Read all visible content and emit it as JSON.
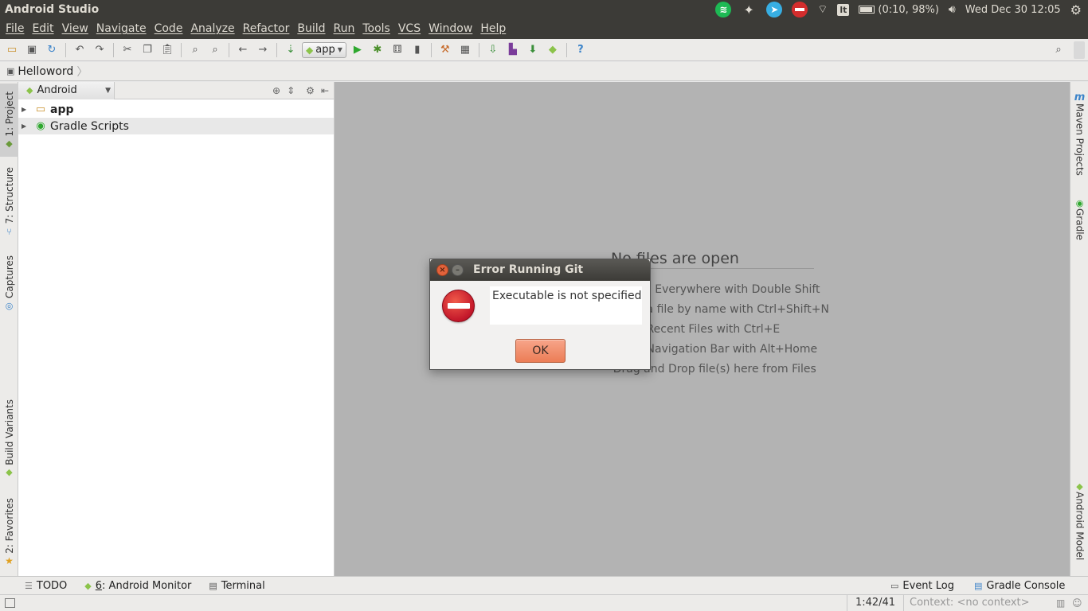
{
  "system_bar": {
    "app_title": "Android Studio",
    "battery": "(0:10, 98%)",
    "datetime": "Wed Dec 30 12:05",
    "keyboard": "lt"
  },
  "menu": {
    "items": [
      "File",
      "Edit",
      "View",
      "Navigate",
      "Code",
      "Analyze",
      "Refactor",
      "Build",
      "Run",
      "Tools",
      "VCS",
      "Window",
      "Help"
    ]
  },
  "toolbar": {
    "run_config": "app",
    "help_label": "?"
  },
  "navbar": {
    "project": "Helloword"
  },
  "left_tabs": {
    "project": "1: Project",
    "structure": "7: Structure",
    "captures": "Captures",
    "build_variants": "Build Variants",
    "favorites": "2: Favorites"
  },
  "right_tabs": {
    "maven": "Maven Projects",
    "gradle": "Gradle",
    "android_model": "Android Model"
  },
  "project_panel": {
    "view": "Android",
    "tree": [
      {
        "label": "app"
      },
      {
        "label": "Gradle Scripts"
      }
    ]
  },
  "editor": {
    "empty_title": "No files are open",
    "hints": [
      "• Search Everywhere with Double Shift",
      "• Open a file by name with Ctrl+Shift+N",
      "• Open Recent Files with Ctrl+E",
      "• Open Navigation Bar with Alt+Home",
      "• Drag and Drop file(s) here from Files"
    ]
  },
  "bottom_tabs": {
    "todo": "TODO",
    "android_monitor_num": "6",
    "android_monitor": ": Android Monitor",
    "terminal": "Terminal",
    "event_log": "Event Log",
    "gradle_console": "Gradle Console"
  },
  "status_bar": {
    "position": "1:42/41",
    "context": "Context: <no context>"
  },
  "dialog": {
    "title": "Error Running Git",
    "message": "Executable is not specified",
    "ok_label": "OK"
  },
  "colors": {
    "system_bar": "#3c3b37",
    "editor_bg": "#b3b3b3",
    "error_red": "#c3172a",
    "ok_button": "#ec7d56",
    "close_button": "#e2623b"
  }
}
